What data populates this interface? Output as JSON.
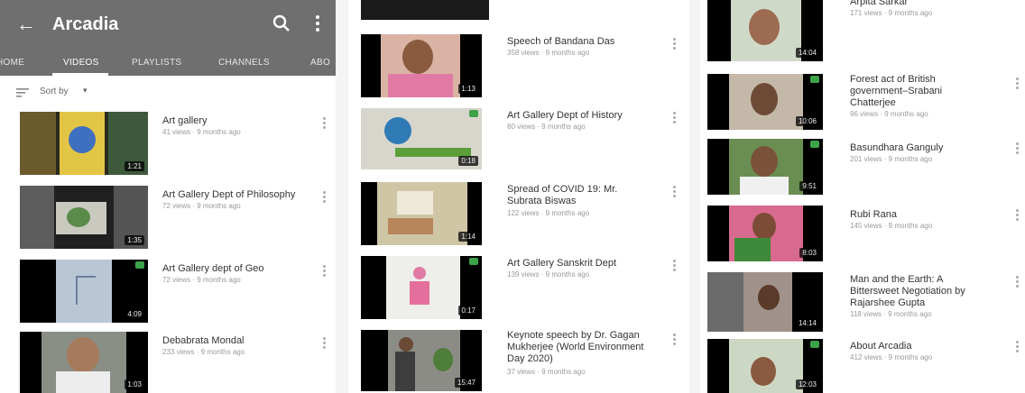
{
  "app": {
    "title": "Arcadia",
    "back_icon": "arrow-back-icon",
    "search_icon": "search-icon",
    "more_icon": "more-vert-icon",
    "bar_color": "#6f6f6f"
  },
  "tabs": [
    {
      "label": "HOME",
      "active": false
    },
    {
      "label": "VIDEOS",
      "active": true
    },
    {
      "label": "PLAYLISTS",
      "active": false
    },
    {
      "label": "CHANNELS",
      "active": false
    },
    {
      "label": "ABO",
      "active": false
    }
  ],
  "sort": {
    "label": "Sort by",
    "icon": "sort-icon"
  },
  "panel1": {
    "videos": [
      {
        "title": "Art gallery",
        "meta": "41 views · 9 months ago",
        "duration": "1:21"
      },
      {
        "title": "Art Gallery Dept of Philosophy",
        "meta": "72 views · 9 months ago",
        "duration": "1:35"
      },
      {
        "title": "Art Gallery dept of Geo",
        "meta": "72 views · 9 months ago",
        "duration": "4:09"
      },
      {
        "title": "Debabrata Mondal",
        "meta": "233 views · 9 months ago",
        "duration": "1:03"
      }
    ]
  },
  "panel2": {
    "videos": [
      {
        "title": "Speech of Bandana Das",
        "meta": "358 views · 9 months ago",
        "duration": "1:13"
      },
      {
        "title": "Art Gallery Dept of History",
        "meta": "80 views · 9 months ago",
        "duration": "0:18"
      },
      {
        "title": "Spread of COVID 19: Mr. Subrata Biswas",
        "meta": "122 views · 9 months ago",
        "duration": "1:14"
      },
      {
        "title": "Art Gallery Sanskrit Dept",
        "meta": "139 views · 9 months ago",
        "duration": "0:17"
      },
      {
        "title": "Keynote speech by Dr. Gagan Mukherjee (World Environment Day 2020)",
        "meta": "37 views · 9 months ago",
        "duration": "15:47"
      }
    ]
  },
  "panel3": {
    "videos": [
      {
        "title": "Arpita Sarkar",
        "meta": "171 views · 9 months ago",
        "duration": "14:04"
      },
      {
        "title": "Forest act of British government–Srabani Chatterjee",
        "meta": "96 views · 9 months ago",
        "duration": "10:06"
      },
      {
        "title": "Basundhara Ganguly",
        "meta": "201 views · 9 months ago",
        "duration": "9:51"
      },
      {
        "title": "Rubi Rana",
        "meta": "145 views · 9 months ago",
        "duration": "8:03"
      },
      {
        "title": "Man and the Earth: A Bittersweet Negotiation by Rajarshee Gupta",
        "meta": "118 views · 9 months ago",
        "duration": "14:14"
      },
      {
        "title": "About Arcadia",
        "meta": "412 views · 9 months ago",
        "duration": "12:03"
      }
    ]
  }
}
